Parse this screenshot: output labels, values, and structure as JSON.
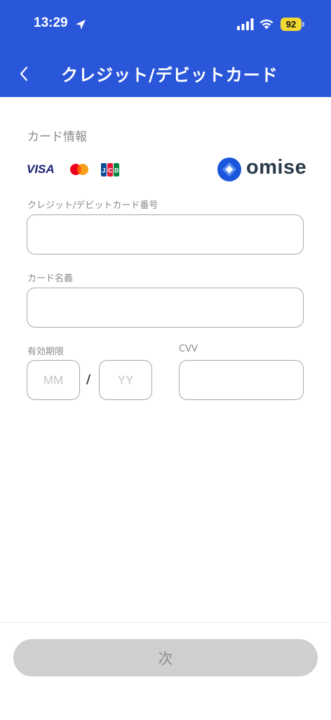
{
  "status_bar": {
    "time": "13:29",
    "battery": "92",
    "icons": [
      "location-arrow-icon",
      "cellular-signal-icon",
      "wifi-icon",
      "battery-icon"
    ]
  },
  "nav": {
    "title": "クレジット/デビットカード",
    "back_icon": "chevron-left-icon"
  },
  "card_info": {
    "section_title": "カード情報",
    "brands": [
      "VISA",
      "mastercard",
      "JCB"
    ],
    "provider": "omise"
  },
  "form": {
    "card_number": {
      "label": "クレジット/デビットカード番号",
      "value": "",
      "placeholder": ""
    },
    "card_name": {
      "label": "カード名義",
      "value": "",
      "placeholder": ""
    },
    "expiry": {
      "label": "有効期限",
      "month_placeholder": "MM",
      "year_placeholder": "YY",
      "separator": "/"
    },
    "cvv": {
      "label": "CVV",
      "value": "",
      "placeholder": ""
    }
  },
  "footer": {
    "next_label": "次",
    "next_enabled": false
  },
  "colors": {
    "header_bg": "#2a56d9",
    "battery": "#f2d833",
    "button_disabled_bg": "#cfcfcf",
    "visa": "#1a1f71",
    "mastercard_red": "#eb001b",
    "mastercard_yellow": "#f79e1b",
    "omise_blue": "#1a56db"
  }
}
